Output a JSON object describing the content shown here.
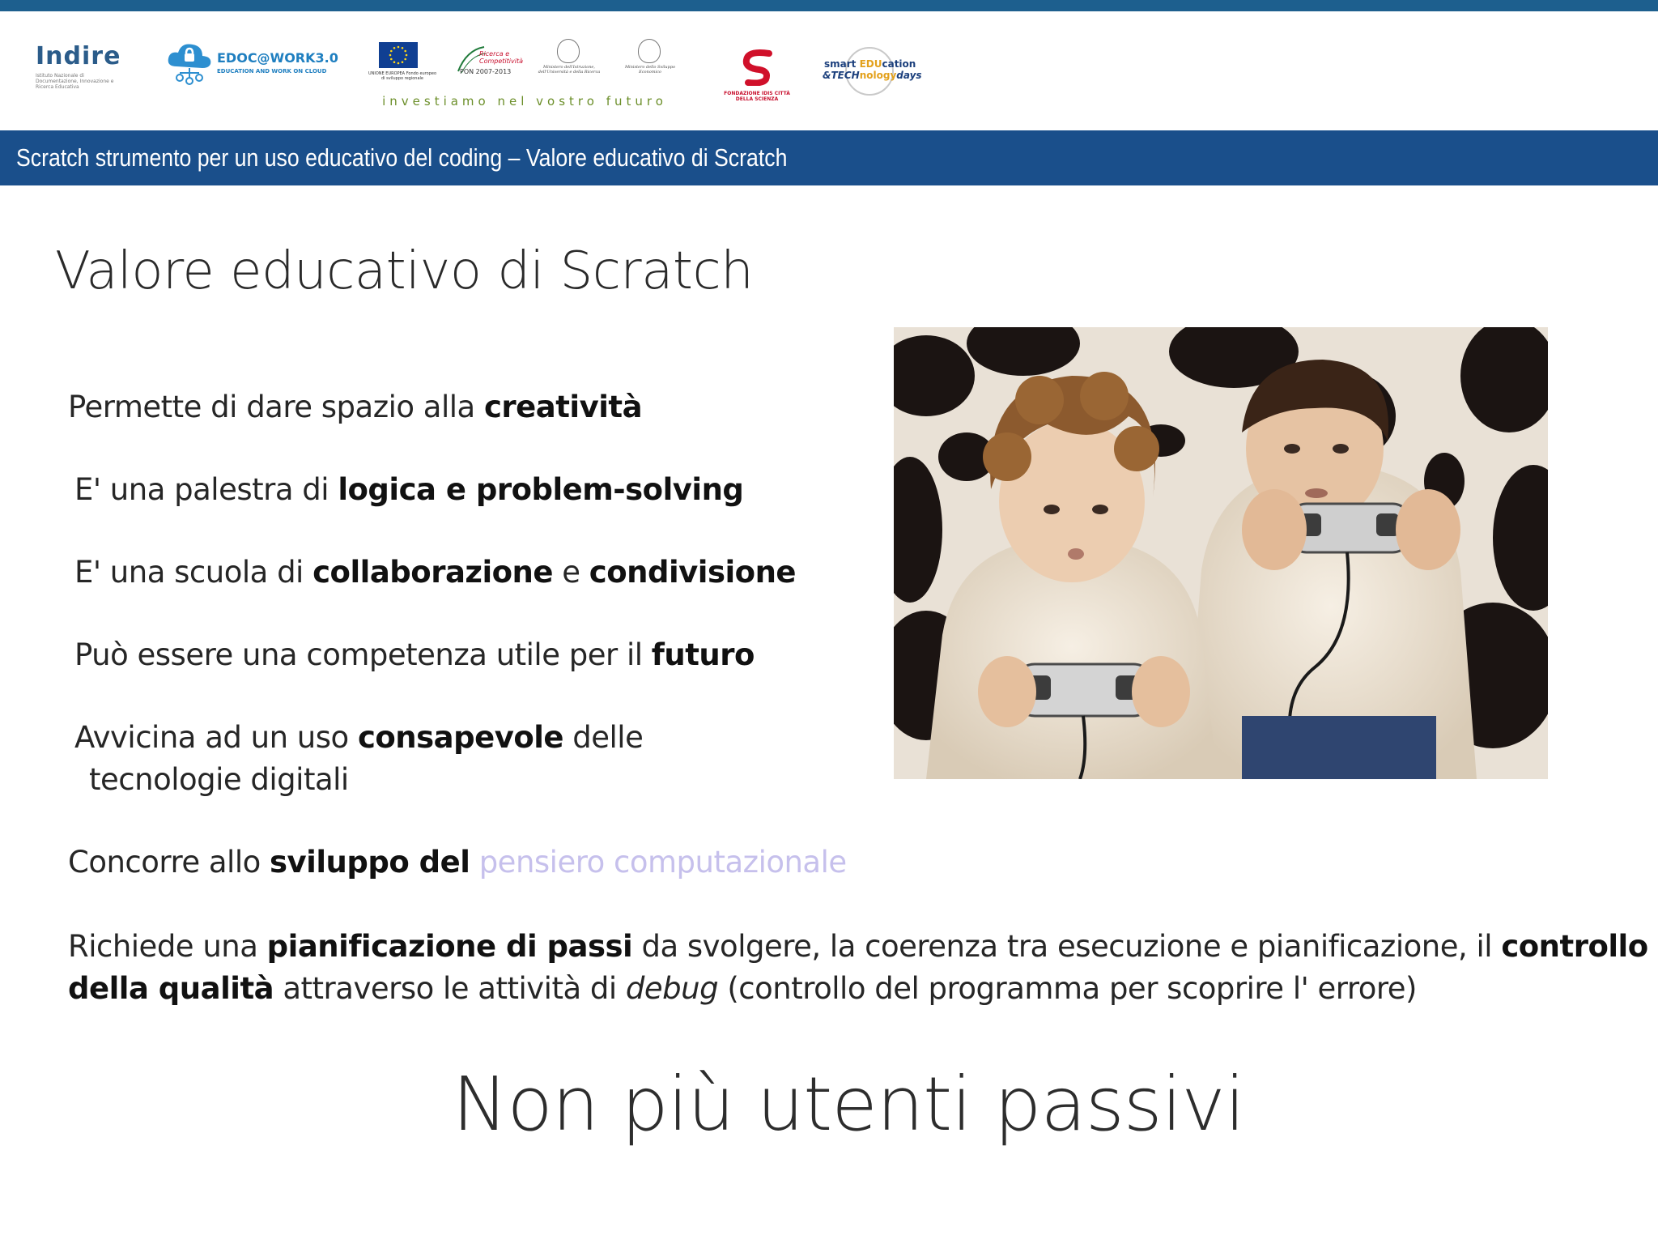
{
  "colors": {
    "band": "#1a4f8b",
    "stripe": "#1d5f8e",
    "highlight_pale": "#c6c0ec"
  },
  "logos": {
    "indire": {
      "word": "Indire",
      "sub": "Istituto Nazionale di Documentazione, Innovazione e Ricerca Educativa"
    },
    "edoc": {
      "title": "EDOC@WORK3.0",
      "subtitle": "EDUCATION AND WORK ON CLOUD"
    },
    "eu": {
      "caption": "UNIONE EUROPEA Fondo europeo di sviluppo regionale"
    },
    "pon": {
      "ricerca": "Ricerca e Competitività",
      "years": "2007-2013",
      "pon": "PON"
    },
    "ministry1": {
      "text": "Ministero dell'Istruzione, dell'Università e della Ricerca"
    },
    "ministry2": {
      "text": "Ministero dello Sviluppo Economico"
    },
    "tagline": "investiamo nel vostro futuro",
    "cds": {
      "text": "FONDAZIONE IDIS CITTÀ DELLA SCIENZA"
    },
    "set": {
      "line1a": "smart ",
      "line1b": "EDU",
      "line1c": "cation",
      "line2a": "&TECH",
      "line2b": "nology",
      "line2c": "days"
    }
  },
  "header": {
    "title": "Scratch strumento per un uso educativo del coding – Valore educativo di Scratch"
  },
  "slide": {
    "title": "Valore educativo di Scratch",
    "points": {
      "p1": {
        "a": "Permette di dare spazio alla ",
        "b": "creatività"
      },
      "p2": {
        "a": "E' una palestra di ",
        "b": "logica e problem-solving"
      },
      "p3": {
        "a": "E' una scuola di ",
        "b": "collaborazione",
        "c": " e ",
        "d": "condivisione"
      },
      "p4": {
        "a": "Può essere una competenza utile per il ",
        "b": "futuro"
      },
      "p5": {
        "a": "Avvicina ad un uso ",
        "b": "consapevole",
        "c": " delle",
        "d": "tecnologie digitali"
      },
      "p6": {
        "a": "Concorre allo ",
        "b": "sviluppo del",
        "c": " ",
        "d": "pensiero computazionale"
      },
      "p7": {
        "a": "Richiede una ",
        "b": "pianificazione di passi",
        "c": " da svolgere, la coerenza tra esecuzione e pianificazione, il ",
        "d": "controllo",
        "e": "della qualità",
        "f": " attraverso le attività di ",
        "g": "debug",
        "h": " (controllo del programma per scoprire l' errore)"
      }
    },
    "closing": "Non più utenti passivi"
  }
}
